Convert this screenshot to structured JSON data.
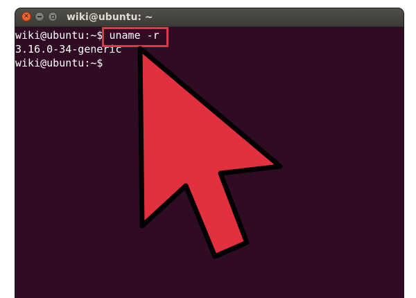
{
  "window": {
    "title": "wiki@ubuntu: ~",
    "close_glyph": "✕",
    "colors": {
      "terminal_bg": "#2f0b24",
      "text": "#ffffff",
      "highlight": "#e5334b",
      "arrow_fill": "#e2303f"
    }
  },
  "terminal": {
    "line1_prompt": "wiki@ubuntu:~$ ",
    "line1_command": "uname -r",
    "line2_output": "3.16.0-34-generic",
    "line3_prompt": "wiki@ubuntu:~$"
  },
  "icons": [
    "close-icon",
    "minimize-icon",
    "maximize-icon",
    "pointer-arrow-icon"
  ]
}
